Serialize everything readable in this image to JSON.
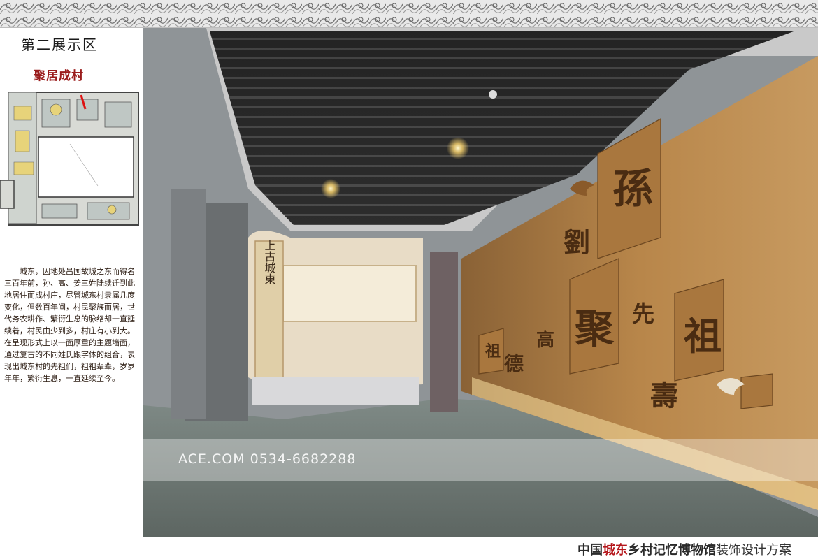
{
  "zone": {
    "title": "第二展示区",
    "subtitle": "聚居成村"
  },
  "description": {
    "paragraph1": "城东，因地处昌国故城之东而得名三百年前，孙、高、姜三姓陆续迁到此地居住而成村庄，尽管城东村隶属几度变化，但数百年间，村民聚族而居，世代务农耕作、繁衍生息的脉络却一直延续着，村民由少到多，村庄有小到大。",
    "paragraph2": "在呈现形式上以一面厚重的主题墙面，通过复古的不同姓氏跟字体的组合，表现出城东村的先祖们，祖祖辈辈，岁岁年年，繁衍生息，一直延续至今。"
  },
  "scene": {
    "scroll_text": "上古城東",
    "wall_characters": [
      "孫",
      "劉",
      "聚",
      "先",
      "祖",
      "德",
      "高",
      "祖",
      "壽"
    ]
  },
  "watermark": "ACE.COM  0534-6682288",
  "footer": {
    "prefix": "中国",
    "highlight": "城东",
    "name": "乡村记忆博物馆",
    "suffix": "装饰设计方案"
  },
  "colors": {
    "accent_red": "#b5161b",
    "subtitle_red": "#9a1c1c",
    "wall_wood": "#b8864a",
    "ceiling_dark": "#2a2a2a",
    "floor_gray": "#6f7873"
  }
}
